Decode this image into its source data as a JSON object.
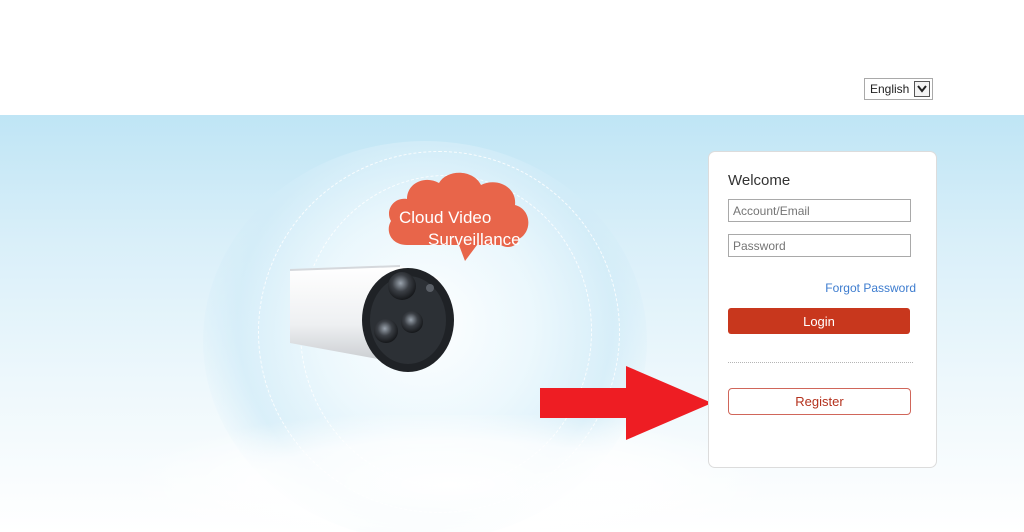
{
  "header": {
    "language": {
      "selected": "English"
    }
  },
  "hero": {
    "bubble_line1": "Cloud Video",
    "bubble_line2": "Surveillance",
    "bubble_color": "#e8654a"
  },
  "login": {
    "welcome": "Welcome",
    "account_placeholder": "Account/Email",
    "password_placeholder": "Password",
    "forgot_label": "Forgot Password",
    "login_label": "Login",
    "register_label": "Register",
    "login_color": "#c8371d"
  },
  "overlay": {
    "arrow_color": "#ee1d23",
    "arrow_icon": "right-arrow-icon"
  }
}
